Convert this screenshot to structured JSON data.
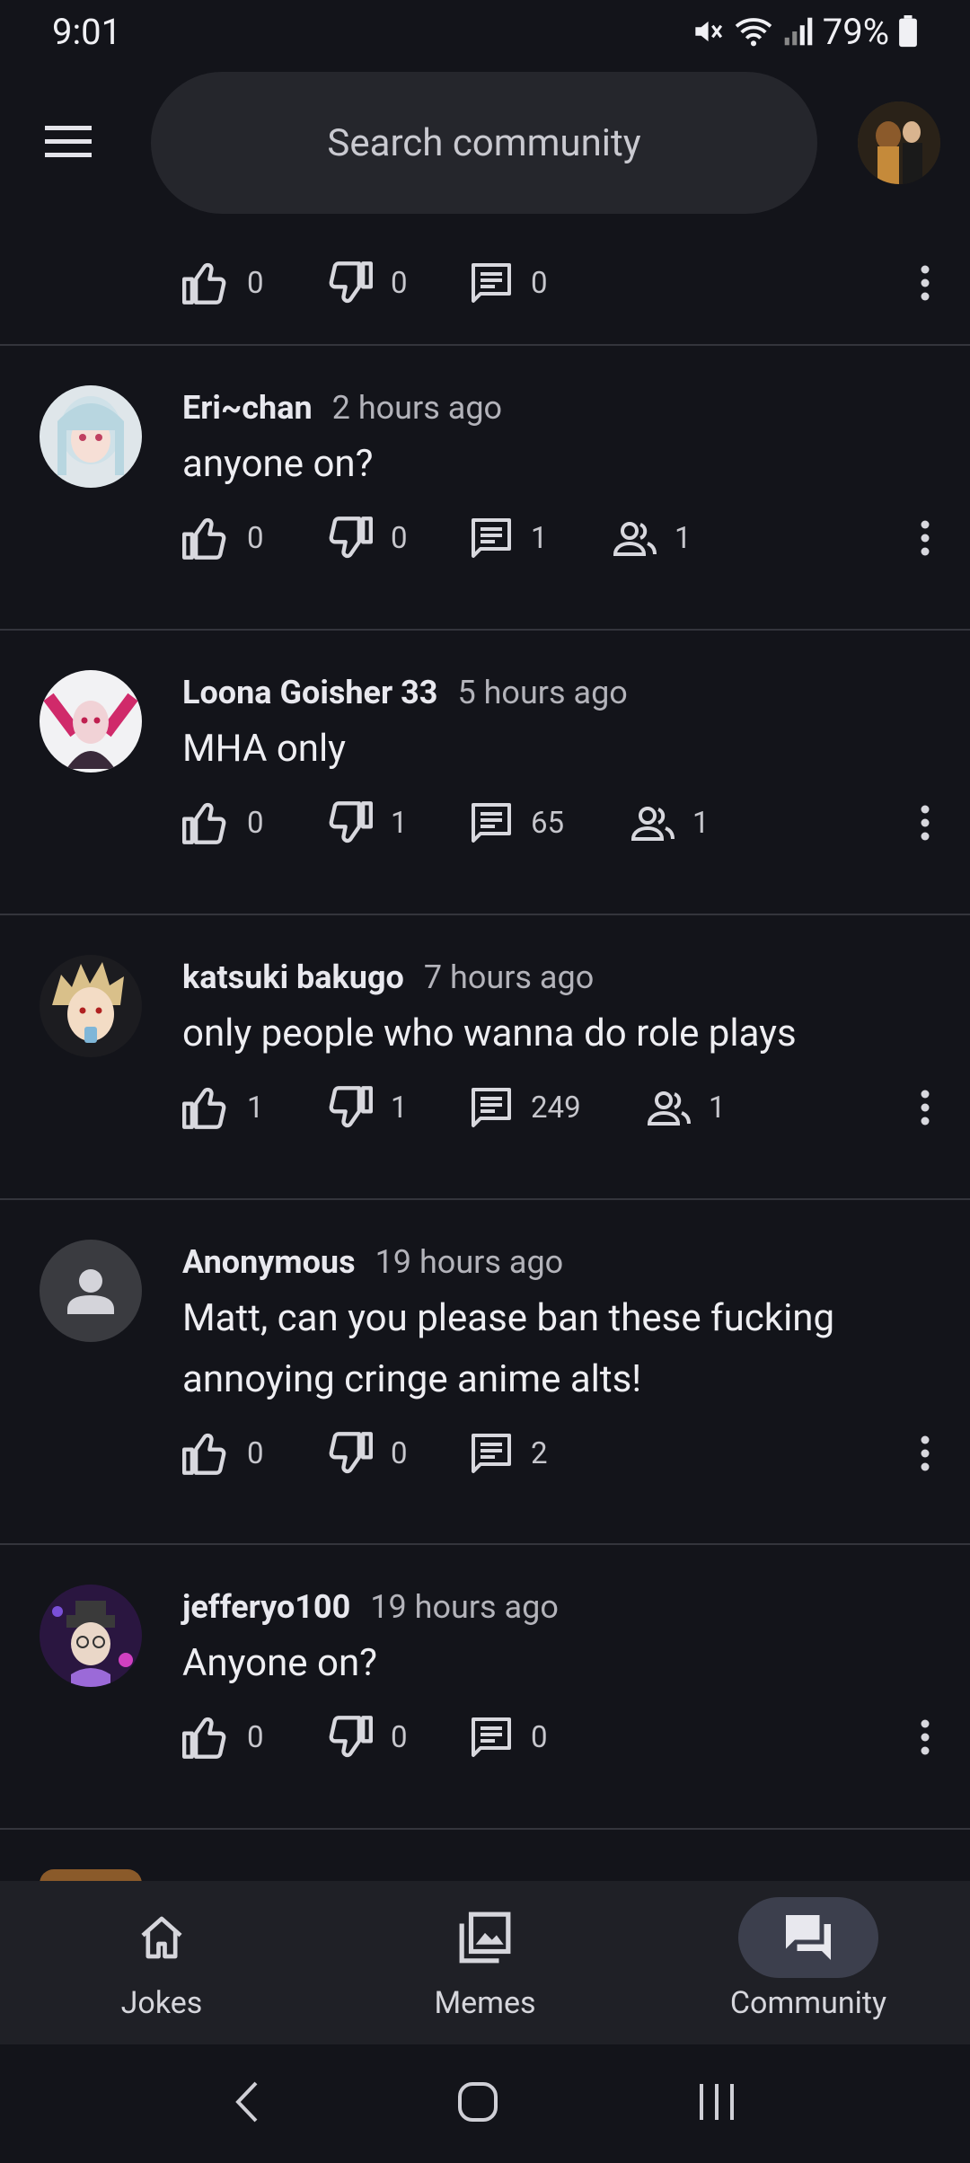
{
  "status": {
    "time": "9:01",
    "battery": "79%"
  },
  "header": {
    "search_placeholder": "Search community"
  },
  "top_partial": {
    "likes": "0",
    "dislikes": "0",
    "comments": "0"
  },
  "posts": [
    {
      "author": "Eri~chan",
      "time": "2 hours ago",
      "text": "anyone on?",
      "likes": "0",
      "dislikes": "0",
      "comments": "1",
      "participants": "1"
    },
    {
      "author": "Loona Goisher 33",
      "time": "5 hours ago",
      "text": "MHA only",
      "likes": "0",
      "dislikes": "1",
      "comments": "65",
      "participants": "1"
    },
    {
      "author": "katsuki bakugo",
      "time": "7 hours ago",
      "text": "only people who wanna do role plays",
      "likes": "1",
      "dislikes": "1",
      "comments": "249",
      "participants": "1"
    },
    {
      "author": "Anonymous",
      "time": "19 hours ago",
      "text": "Matt, can you please ban these fucking annoying cringe anime alts!",
      "likes": "0",
      "dislikes": "0",
      "comments": "2"
    },
    {
      "author": "jefferyo100",
      "time": "19 hours ago",
      "text": "Anyone on?",
      "likes": "0",
      "dislikes": "0",
      "comments": "0"
    }
  ],
  "bottom_nav": [
    {
      "label": "Jokes",
      "icon": "home-icon"
    },
    {
      "label": "Memes",
      "icon": "gallery-icon"
    },
    {
      "label": "Community",
      "icon": "forum-icon",
      "active": true
    }
  ],
  "colors": {
    "background": "#13141a",
    "surface": "#25262c",
    "active_pill": "#3c3f4d"
  }
}
